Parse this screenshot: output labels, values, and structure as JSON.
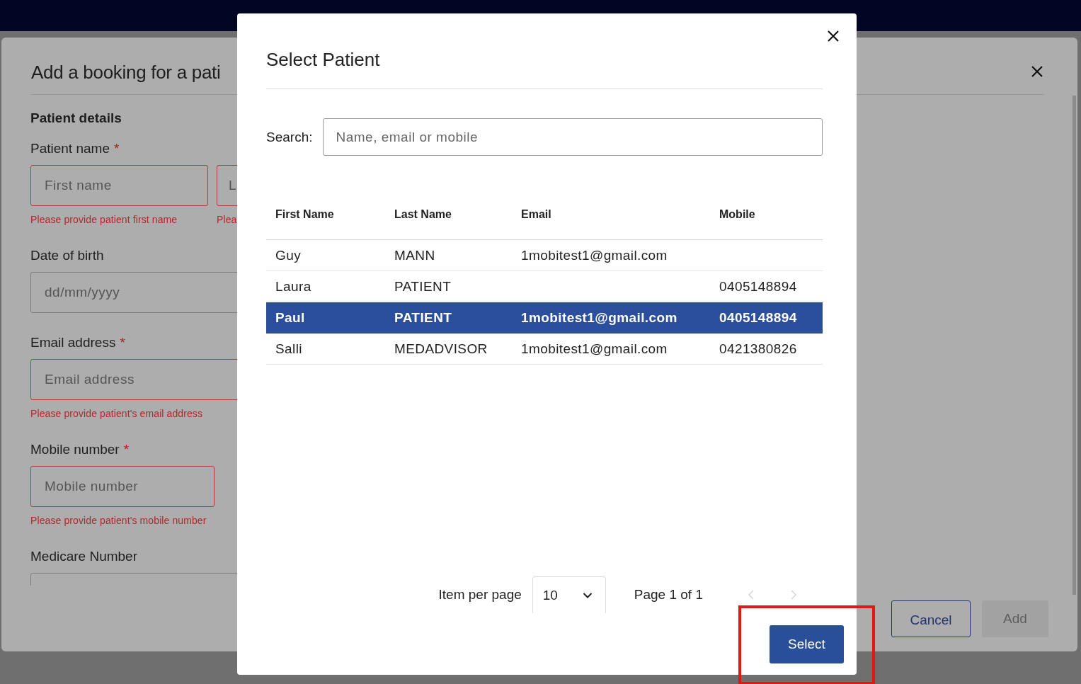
{
  "booking_dialog": {
    "title": "Add a booking for a pati",
    "section": "Patient details",
    "fields": [
      {
        "label": "Patient name",
        "required_mark": "*",
        "inputs": [
          {
            "placeholder": "First name",
            "invalid": true,
            "error": "Please provide patient first name"
          },
          {
            "placeholder": "L",
            "invalid": true,
            "error": "Plea"
          }
        ]
      },
      {
        "label": "Date of birth",
        "inputs": [
          {
            "placeholder": "dd/mm/yyyy",
            "invalid": false
          }
        ]
      },
      {
        "label": "Email address",
        "required_mark": "*",
        "inputs": [
          {
            "placeholder": "Email address",
            "invalid": true,
            "error": "Please provide patient's email address"
          }
        ]
      },
      {
        "label": "Mobile number",
        "required_mark": "*",
        "inputs": [
          {
            "placeholder": "Mobile number",
            "invalid": true,
            "error": "Please provide patient's mobile number"
          }
        ]
      },
      {
        "label": "Medicare Number",
        "inputs": [
          {
            "invalid": false
          }
        ]
      }
    ],
    "buttons": [
      {
        "label": "Cancel",
        "kind": "outline",
        "disabled": false
      },
      {
        "label": "Add",
        "kind": "primary",
        "disabled": true
      }
    ]
  },
  "select_patient_dialog": {
    "title": "Select Patient",
    "search": {
      "label": "Search:",
      "placeholder": "Name, email or mobile"
    },
    "table": {
      "columns": [
        "First Name",
        "Last Name",
        "Email",
        "Mobile"
      ],
      "rows": [
        {
          "cells": [
            "Guy",
            "MANN",
            "1mobitest1@gmail.com",
            ""
          ],
          "selected": false
        },
        {
          "cells": [
            "Laura",
            "PATIENT",
            "",
            "0405148894"
          ],
          "selected": false
        },
        {
          "cells": [
            "Paul",
            "PATIENT",
            "1mobitest1@gmail.com",
            "0405148894"
          ],
          "selected": true
        },
        {
          "cells": [
            "Salli",
            "MEDADVISOR",
            "1mobitest1@gmail.com",
            "0421380826"
          ],
          "selected": false
        }
      ]
    },
    "pagination": {
      "label": "Item per page",
      "page_size": "10",
      "page_info": "Page 1 of 1",
      "previous_disabled": true,
      "next_disabled": true
    },
    "buttons": [
      {
        "label": "Select",
        "kind": "primary",
        "disabled": false
      }
    ]
  }
}
